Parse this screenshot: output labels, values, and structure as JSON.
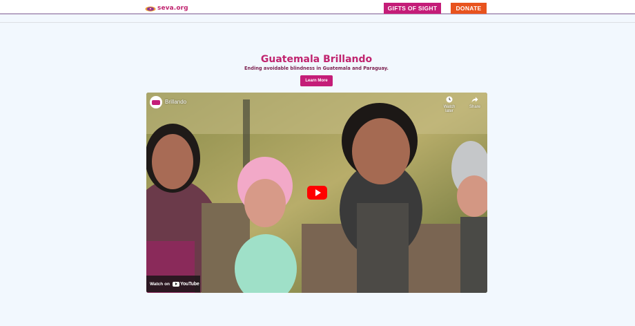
{
  "header": {
    "logo_text": "seva.org",
    "gifts_label": "GIFTS OF SIGHT",
    "donate_label": "DONATE"
  },
  "hero": {
    "title": "Guatemala Brillando",
    "subtitle": "Ending avoidable blindness in Guatemala and Paraguay.",
    "cta_label": "Learn More"
  },
  "video": {
    "title": "Brillando",
    "watch_later_label": "Watch later",
    "share_label": "Share",
    "watch_on_label": "Watch on",
    "platform_name": "YouTube",
    "icons": [
      "clock-icon",
      "share-arrow-icon",
      "play-icon",
      "youtube-logo-icon"
    ]
  },
  "colors": {
    "brand_magenta": "#c41d78",
    "donate_orange": "#e8531e",
    "page_bg": "#f2f8fe",
    "play_red": "#ff0000"
  }
}
